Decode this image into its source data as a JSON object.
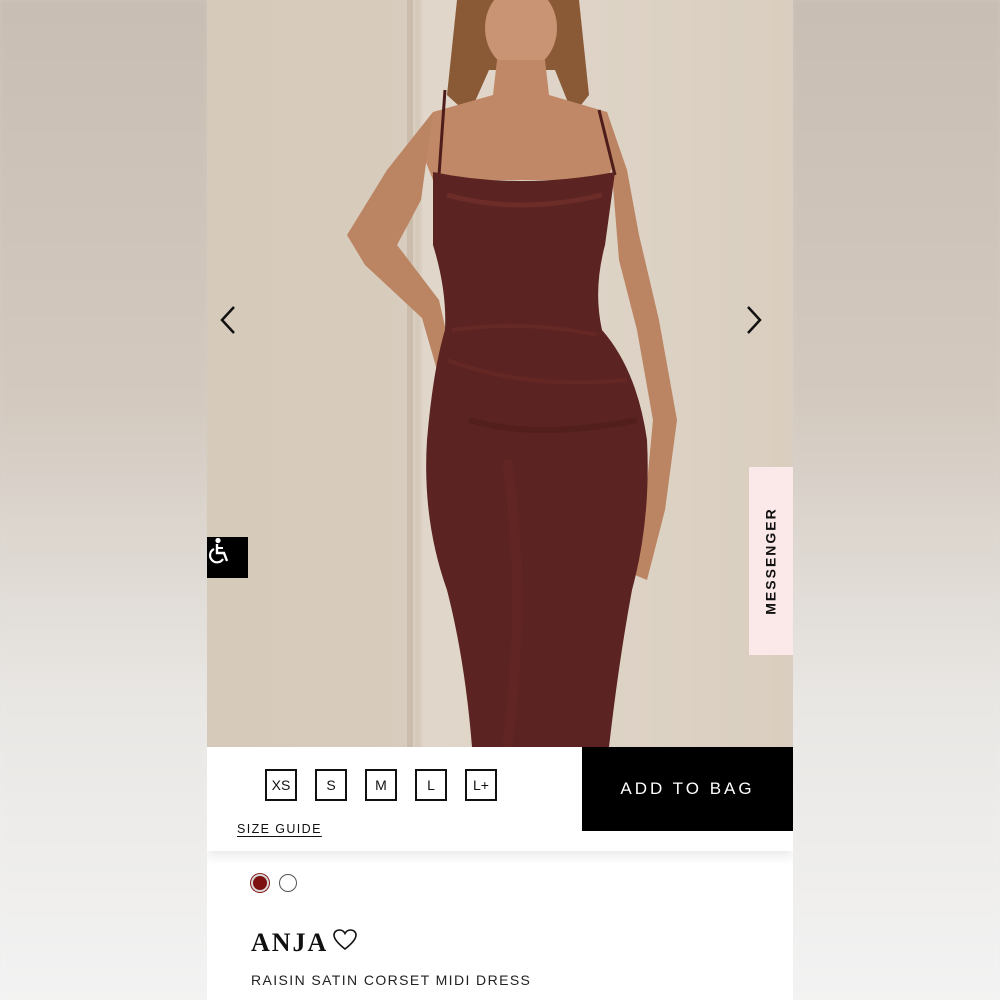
{
  "product": {
    "name": "ANJA",
    "subtitle": "RAISIN SATIN CORSET MIDI DRESS",
    "image_alt": "model wearing the dress",
    "icon": {
      "previous": "chevron-left-icon",
      "next": "chevron-right-icon",
      "wishlist": "heart-outline-icon"
    }
  },
  "sizes": [
    "XS",
    "S",
    "M",
    "L",
    "L+"
  ],
  "size_guide_label": "SIZE GUIDE",
  "add_to_bag_label": "ADD TO BAG",
  "messenger_label": "MESSENGER",
  "accessibility_icon": "wheelchair-icon",
  "swatches": [
    {
      "name": "raisin",
      "color": "#7d1010",
      "selected": true
    },
    {
      "name": "white",
      "color": "#ffffff",
      "selected": false
    }
  ],
  "colors": {
    "accent": "#000000",
    "messenger_bg": "#fbe9ea",
    "dress": "#5b2321"
  }
}
